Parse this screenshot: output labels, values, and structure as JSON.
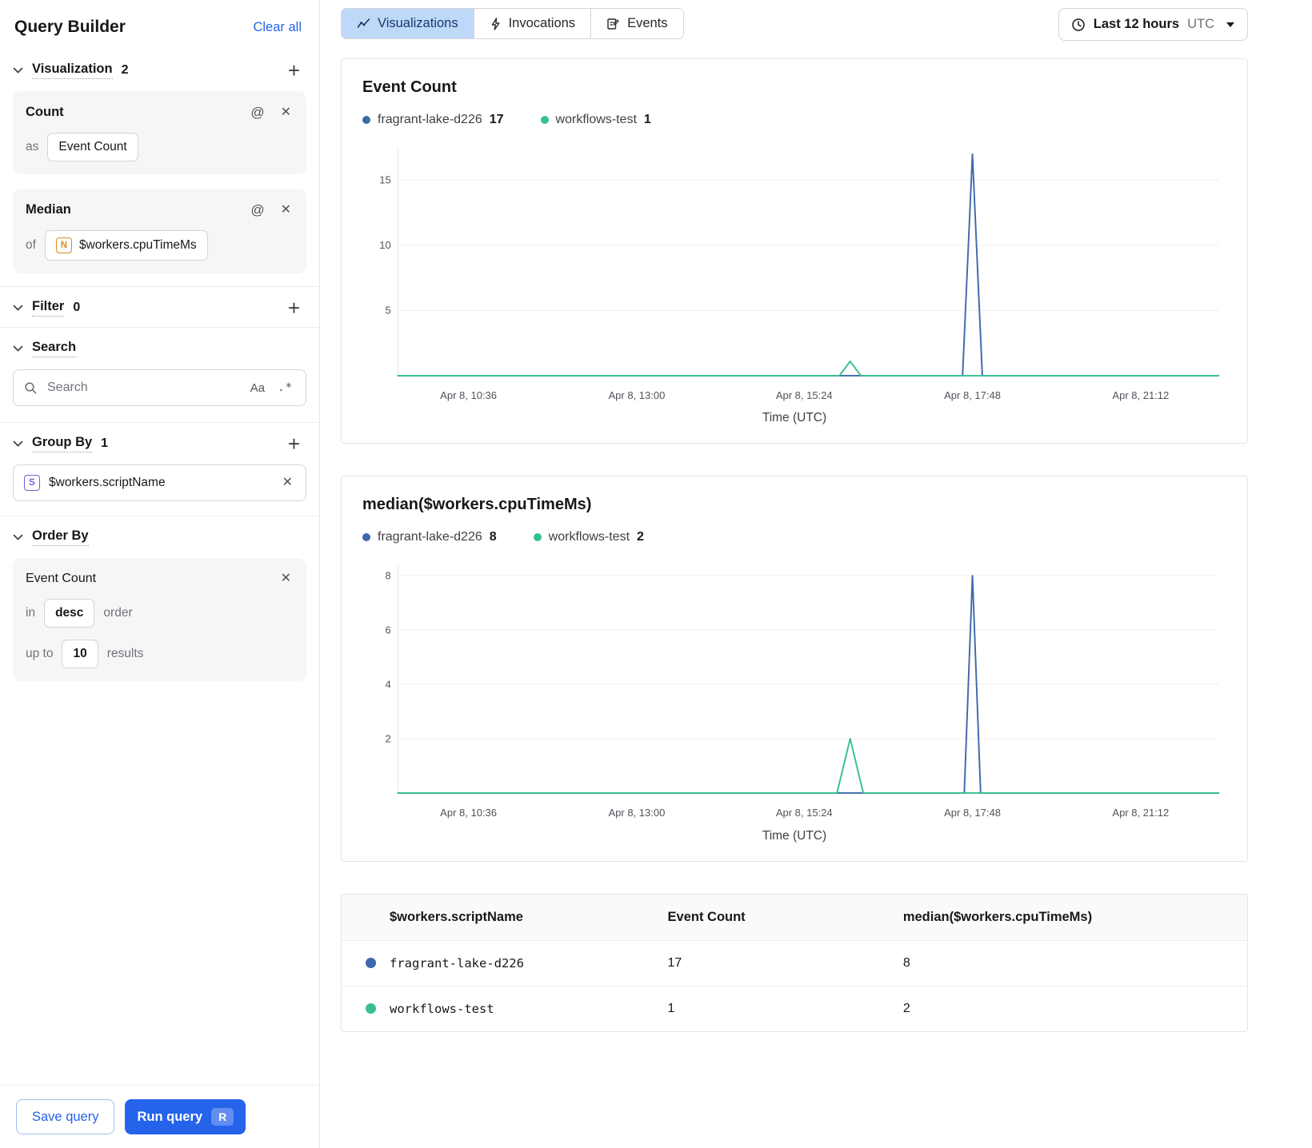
{
  "sidebar": {
    "title": "Query Builder",
    "clear_all": "Clear all",
    "sections": {
      "visualization": {
        "label": "Visualization",
        "count": "2"
      },
      "filter": {
        "label": "Filter",
        "count": "0"
      },
      "search": {
        "label": "Search"
      },
      "group_by": {
        "label": "Group By",
        "count": "1"
      },
      "order_by": {
        "label": "Order By"
      }
    },
    "count_card": {
      "title": "Count",
      "as_label": "as",
      "value": "Event Count"
    },
    "median_card": {
      "title": "Median",
      "of_label": "of",
      "badge": "N",
      "value": "$workers.cpuTimeMs"
    },
    "search_input": {
      "placeholder": "Search",
      "case_toggle": "Aa",
      "regex_toggle": ".*"
    },
    "group_item": {
      "badge": "S",
      "value": "$workers.scriptName"
    },
    "order_card": {
      "title": "Event Count",
      "in_label": "in",
      "direction": "desc",
      "order_label": "order",
      "upto_label": "up to",
      "limit": "10",
      "results_label": "results"
    },
    "save_button": "Save query",
    "run_button": "Run query",
    "run_shortcut": "R"
  },
  "header": {
    "tabs": [
      {
        "label": "Visualizations"
      },
      {
        "label": "Invocations"
      },
      {
        "label": "Events"
      }
    ],
    "active_tab": "Visualizations",
    "time_range": {
      "label": "Last 12 hours",
      "timezone": "UTC"
    }
  },
  "chart_data": [
    {
      "type": "line",
      "title": "Event Count",
      "xlabel": "Time (UTC)",
      "ylim": [
        0,
        17.5
      ],
      "yticks": [
        5,
        10,
        15
      ],
      "grid": true,
      "legend_position": "top-left",
      "legend": [
        {
          "name": "fragrant-lake-d226",
          "value": 17,
          "color": "#3e68ad"
        },
        {
          "name": "workflows-test",
          "value": 1,
          "color": "#35c08d"
        }
      ],
      "x_ticks": [
        {
          "label": "Apr 8, 10:36",
          "pos": 0.086
        },
        {
          "label": "Apr 8, 13:00",
          "pos": 0.291
        },
        {
          "label": "Apr 8, 15:24",
          "pos": 0.495
        },
        {
          "label": "Apr 8, 17:48",
          "pos": 0.7
        },
        {
          "label": "Apr 8, 21:12",
          "pos": 0.905
        }
      ],
      "series": [
        {
          "name": "fragrant-lake-d226",
          "color": "#3e68ad",
          "points": [
            [
              0,
              0
            ],
            [
              0.688,
              0
            ],
            [
              0.7,
              17
            ],
            [
              0.712,
              0
            ],
            [
              1,
              0
            ]
          ]
        },
        {
          "name": "workflows-test",
          "color": "#35c08d",
          "points": [
            [
              0,
              0
            ],
            [
              0.538,
              0
            ],
            [
              0.551,
              1.1
            ],
            [
              0.564,
              0
            ],
            [
              1,
              0
            ]
          ]
        }
      ]
    },
    {
      "type": "line",
      "title": "median($workers.cpuTimeMs)",
      "xlabel": "Time (UTC)",
      "ylim": [
        0,
        8.4
      ],
      "yticks": [
        2,
        4,
        6,
        8
      ],
      "grid": true,
      "legend_position": "top-left",
      "legend": [
        {
          "name": "fragrant-lake-d226",
          "value": 8,
          "color": "#3e68ad"
        },
        {
          "name": "workflows-test",
          "value": 2,
          "color": "#35c08d"
        }
      ],
      "x_ticks": [
        {
          "label": "Apr 8, 10:36",
          "pos": 0.086
        },
        {
          "label": "Apr 8, 13:00",
          "pos": 0.291
        },
        {
          "label": "Apr 8, 15:24",
          "pos": 0.495
        },
        {
          "label": "Apr 8, 17:48",
          "pos": 0.7
        },
        {
          "label": "Apr 8, 21:12",
          "pos": 0.905
        }
      ],
      "series": [
        {
          "name": "fragrant-lake-d226",
          "color": "#3e68ad",
          "points": [
            [
              0,
              0
            ],
            [
              0.69,
              0
            ],
            [
              0.7,
              8
            ],
            [
              0.71,
              0
            ],
            [
              1,
              0
            ]
          ]
        },
        {
          "name": "workflows-test",
          "color": "#35c08d",
          "points": [
            [
              0,
              0
            ],
            [
              0.535,
              0
            ],
            [
              0.551,
              2
            ],
            [
              0.567,
              0
            ],
            [
              1,
              0
            ]
          ]
        }
      ]
    }
  ],
  "table": {
    "columns": [
      "$workers.scriptName",
      "Event Count",
      "median($workers.cpuTimeMs)"
    ],
    "rows": [
      {
        "color": "#3e68ad",
        "name": "fragrant-lake-d226",
        "event_count": "17",
        "median": "8"
      },
      {
        "color": "#35c08d",
        "name": "workflows-test",
        "event_count": "1",
        "median": "2"
      }
    ]
  }
}
